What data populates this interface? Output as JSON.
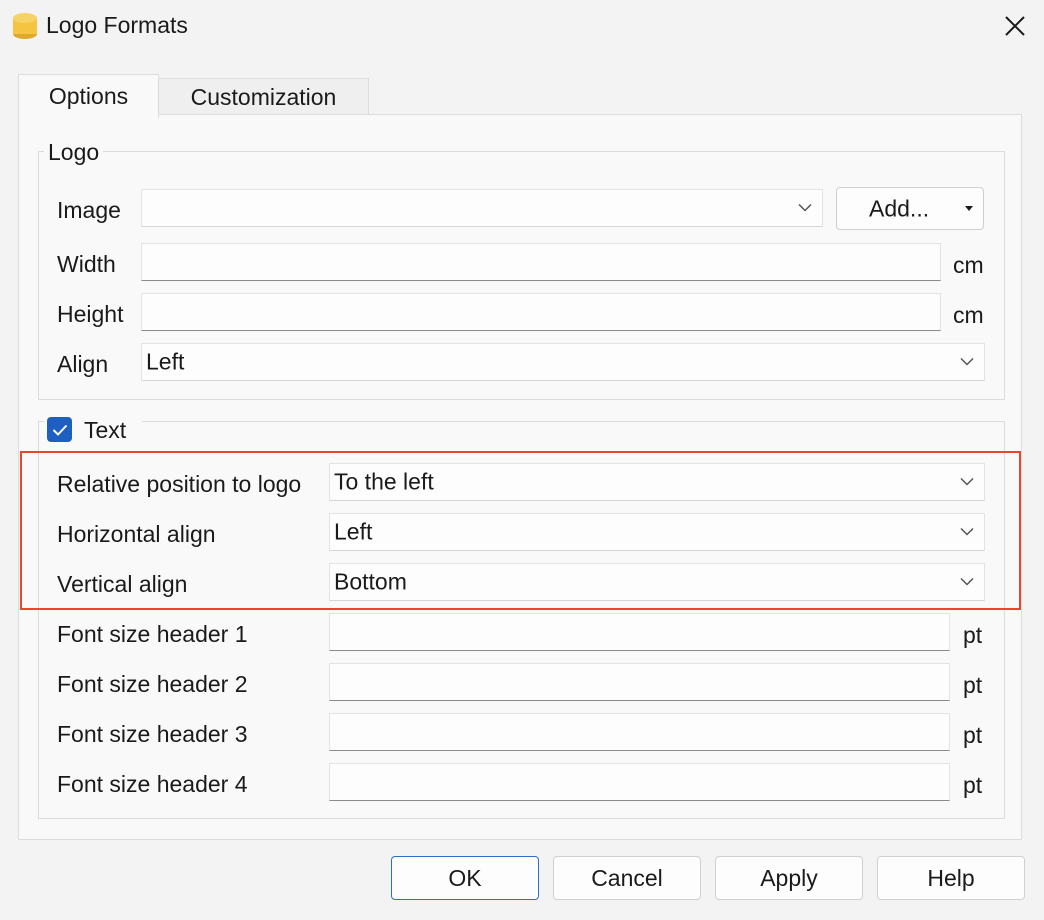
{
  "window": {
    "title": "Logo Formats",
    "app_icon": "banana-coin-stack-icon",
    "close_icon": "close-icon"
  },
  "tabs": [
    {
      "label": "Options",
      "active": true
    },
    {
      "label": "Customization",
      "active": false
    }
  ],
  "logo_group": {
    "legend": "Logo",
    "image_label": "Image",
    "image_value": "",
    "add_button": "Add...",
    "width_label": "Width",
    "width_value": "",
    "width_unit": "cm",
    "height_label": "Height",
    "height_value": "",
    "height_unit": "cm",
    "align_label": "Align",
    "align_value": "Left"
  },
  "text_group": {
    "legend": "Text",
    "checked": true,
    "relpos_label": "Relative position to logo",
    "relpos_value": "To the left",
    "halign_label": "Horizontal align",
    "halign_value": "Left",
    "valign_label": "Vertical align",
    "valign_value": "Bottom",
    "fs1_label": "Font size header 1",
    "fs2_label": "Font size header 2",
    "fs3_label": "Font size header 3",
    "fs4_label": "Font size header 4",
    "fs_unit": "pt"
  },
  "buttons": {
    "ok": "OK",
    "cancel": "Cancel",
    "apply": "Apply",
    "help": "Help"
  },
  "colors": {
    "highlight": "#e8472b",
    "accent": "#1f5fbf",
    "icon_yellow": "#f5c542"
  }
}
